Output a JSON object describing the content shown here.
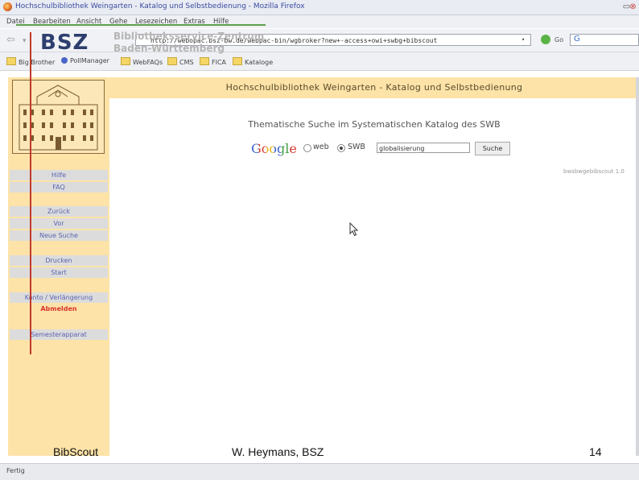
{
  "window": {
    "title": "Hochschulbibliothek Weingarten - Katalog und Selbstbedienung - Mozilla Firefox"
  },
  "menu": [
    "Datei",
    "Bearbeiten",
    "Ansicht",
    "Gehe",
    "Lesezeichen",
    "Extras",
    "Hilfe"
  ],
  "nav": {
    "url": "http://webopac.bsz-bw.de/webpac-bin/wgbroker?new+-access+owi+swbg+bibscout",
    "go_label": "Go"
  },
  "bookmarks": [
    "Big Brother",
    "PollManager",
    "WebFAQs",
    "CMS",
    "FICA",
    "Kataloge"
  ],
  "logo": {
    "text": "BSZ",
    "line1": "Bibliotheksservice-Zentrum",
    "line2": "Baden-Württemberg"
  },
  "sidebar": {
    "group1": [
      "Hilfe",
      "FAQ"
    ],
    "group2": [
      "Zurück",
      "Vor",
      "Neue Suche"
    ],
    "group3": [
      "Drucken",
      "Start"
    ],
    "konto": "Konto / Verlängerung",
    "abmelden": "Abmelden",
    "semester": "Semesterapparat"
  },
  "main": {
    "header": "Hochschulbibliothek Weingarten - Katalog und Selbstbedienung",
    "subtitle": "Thematische Suche im Systematischen Katalog des SWB",
    "google_logo": "Google",
    "radio_web": "web",
    "radio_swb": "SWB",
    "query": "globalisierung",
    "search_button": "Suche",
    "version": "bwsbwgebibscout 1.0"
  },
  "footer": {
    "left": "BibScout",
    "center": "W. Heymans, BSZ",
    "page": "14"
  },
  "status": "Fertig",
  "colors": {
    "sidebar_bg": "#fde3a8",
    "link_blue": "#5a64b0",
    "logout_red": "#d9332d",
    "overlay_red": "#c0392b",
    "overlay_green": "#5ca04a"
  }
}
